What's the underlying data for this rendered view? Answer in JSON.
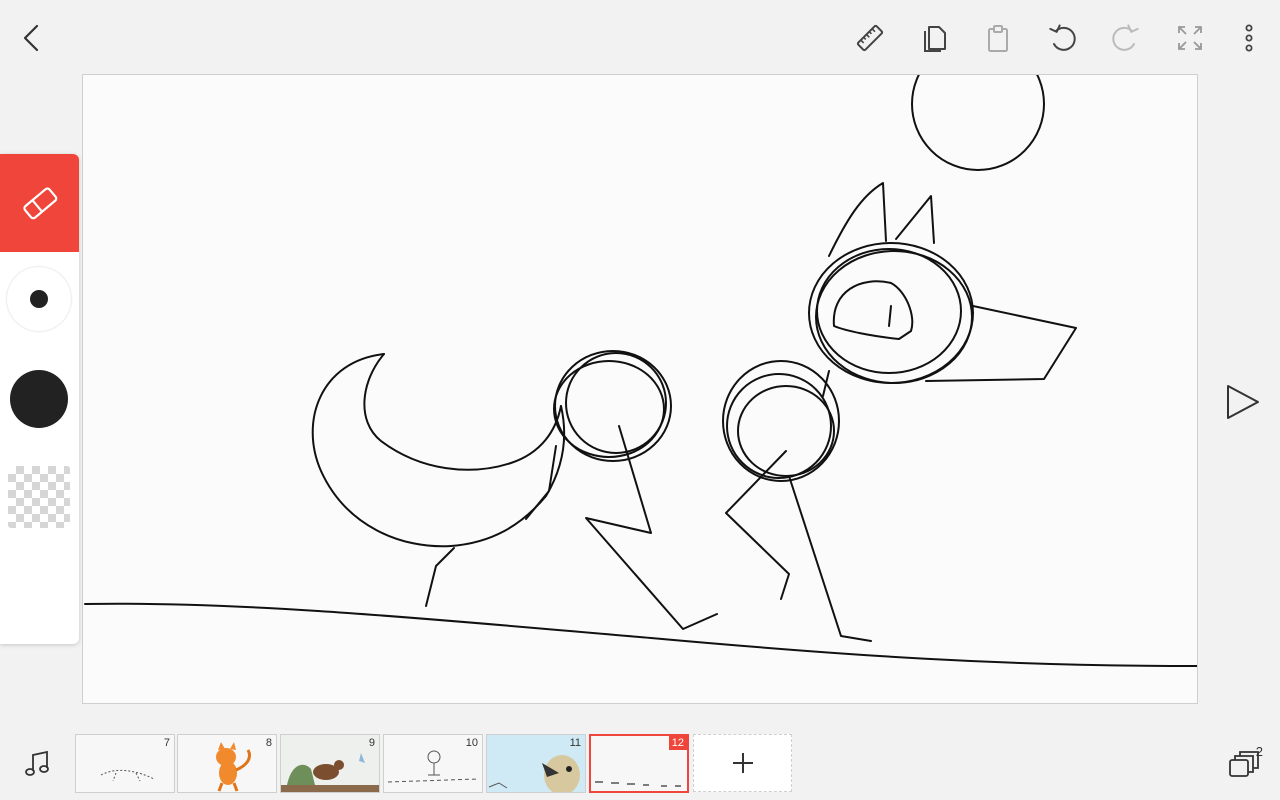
{
  "topbar": {
    "icons": [
      "back-arrow-icon",
      "ruler-icon",
      "copy-icon",
      "paste-icon",
      "undo-icon",
      "redo-icon",
      "fullscreen-icon",
      "more-vert-icon"
    ]
  },
  "tools": {
    "active_tool": "eraser",
    "brush_color": "#222222",
    "accent_color": "#f0453a"
  },
  "timeline": {
    "frames": [
      {
        "number": "7"
      },
      {
        "number": "8"
      },
      {
        "number": "9"
      },
      {
        "number": "10"
      },
      {
        "number": "11"
      },
      {
        "number": "12"
      }
    ],
    "selected_frame": "12",
    "layer_count": "2"
  }
}
